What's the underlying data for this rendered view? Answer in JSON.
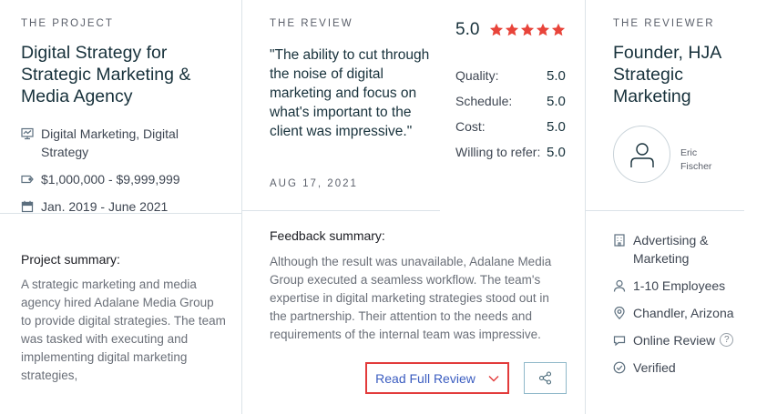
{
  "project": {
    "eyebrow": "THE PROJECT",
    "title": "Digital Strategy for Strategic Marketing & Media Agency",
    "service": "Digital Marketing, Digital Strategy",
    "budget": "$1,000,000 - $9,999,999",
    "dates": "Jan. 2019 - June 2021",
    "summary_label": "Project summary:",
    "summary": "A strategic marketing and media agency hired Adalane Media Group to provide digital strategies. The team was tasked with executing and implementing digital marketing strategies,"
  },
  "review": {
    "eyebrow": "THE REVIEW",
    "quote": "\"The ability to cut through the noise of digital marketing and focus on what's important to the client was impressive.\"",
    "date": "AUG 17, 2021",
    "overall": "5.0",
    "star_count": 5,
    "star_color": "#e8443a",
    "scores": [
      {
        "label": "Quality:",
        "value": "5.0"
      },
      {
        "label": "Schedule:",
        "value": "5.0"
      },
      {
        "label": "Cost:",
        "value": "5.0"
      },
      {
        "label": "Willing to refer:",
        "value": "5.0"
      }
    ],
    "feedback_label": "Feedback summary:",
    "feedback": "Although the result was unavailable, Adalane Media Group executed a seamless workflow. The team's expertise in digital marketing strategies stood out in the partnership. Their attention to the needs and requirements of the internal team was impressive.",
    "read_full_label": "Read Full Review"
  },
  "reviewer": {
    "eyebrow": "THE REVIEWER",
    "title": "Founder, HJA Strategic Marketing",
    "first_name": "Eric",
    "last_name": "Fischer",
    "industry": "Advertising & Marketing",
    "size": "1-10 Employees",
    "location": "Chandler, Arizona",
    "review_type": "Online Review",
    "help_glyph": "?",
    "status": "Verified"
  },
  "colors": {
    "accent_red": "#e23b3b",
    "link_blue": "#3a5cc0",
    "divider": "#dce3e8"
  }
}
